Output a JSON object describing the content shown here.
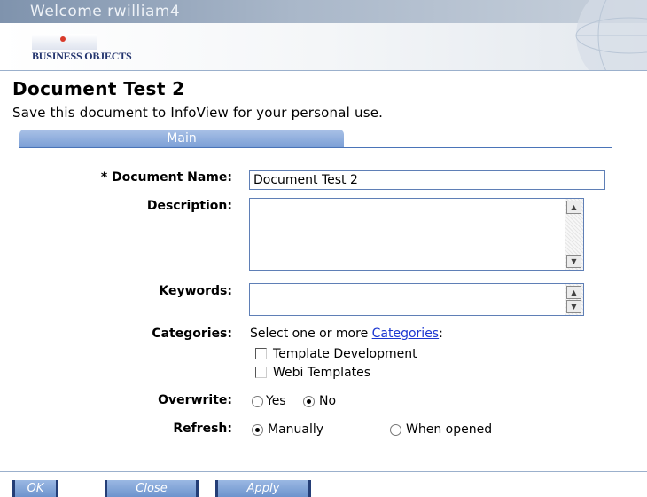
{
  "header": {
    "welcome": "Welcome rwilliam4",
    "logo_text": "BUSINESS OBJECTS"
  },
  "document": {
    "title": "Document Test 2",
    "subtitle": "Save this document to InfoView for your personal use."
  },
  "tabs": [
    {
      "label": "Main",
      "active": true
    }
  ],
  "form": {
    "document_name": {
      "label": "* Document Name:",
      "value": "Document Test 2"
    },
    "description": {
      "label": "Description:",
      "value": ""
    },
    "keywords": {
      "label": "Keywords:",
      "value": ""
    },
    "categories": {
      "label": "Categories:",
      "prompt": "Select one or more ",
      "link": "Categories",
      "suffix": ":",
      "options": [
        {
          "label": "Template Development",
          "checked": false
        },
        {
          "label": "Webi Templates",
          "checked": false
        }
      ]
    },
    "overwrite": {
      "label": "Overwrite:",
      "options": [
        {
          "label": "Yes",
          "selected": false
        },
        {
          "label": "No",
          "selected": true
        }
      ]
    },
    "refresh": {
      "label": "Refresh:",
      "options": [
        {
          "label": "Manually",
          "selected": true
        },
        {
          "label": "When opened",
          "selected": false
        }
      ]
    }
  },
  "buttons": {
    "ok": "OK",
    "close": "Close",
    "apply": "Apply"
  },
  "colors": {
    "accent": "#7b9fd6",
    "link": "#1b36d1",
    "button_border": "#243e77"
  }
}
